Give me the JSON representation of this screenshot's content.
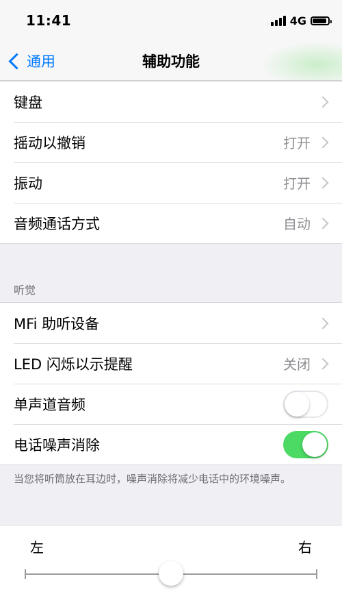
{
  "status_bar": {
    "time": "11:41",
    "network": "4G",
    "battery_level": 0.9
  },
  "nav": {
    "back_label": "通用",
    "title": "辅助功能"
  },
  "group1": {
    "rows": [
      {
        "label": "键盘",
        "value": ""
      },
      {
        "label": "摇动以撤销",
        "value": "打开"
      },
      {
        "label": "振动",
        "value": "打开"
      },
      {
        "label": "音频通话方式",
        "value": "自动"
      }
    ]
  },
  "hearing": {
    "header": "听觉",
    "rows": [
      {
        "label": "MFi 助听设备",
        "value": ""
      },
      {
        "label": "LED 闪烁以示提醒",
        "value": "关闭"
      },
      {
        "label": "单声道音频",
        "toggle": false
      },
      {
        "label": "电话噪声消除",
        "toggle": true
      }
    ],
    "footer": "当您将听筒放在耳边时，噪声消除将减少电话中的环境噪声。"
  },
  "balance": {
    "left_label": "左",
    "right_label": "右",
    "position": 0.5
  },
  "colors": {
    "accent": "#007aff",
    "toggle_on": "#4cd964"
  }
}
